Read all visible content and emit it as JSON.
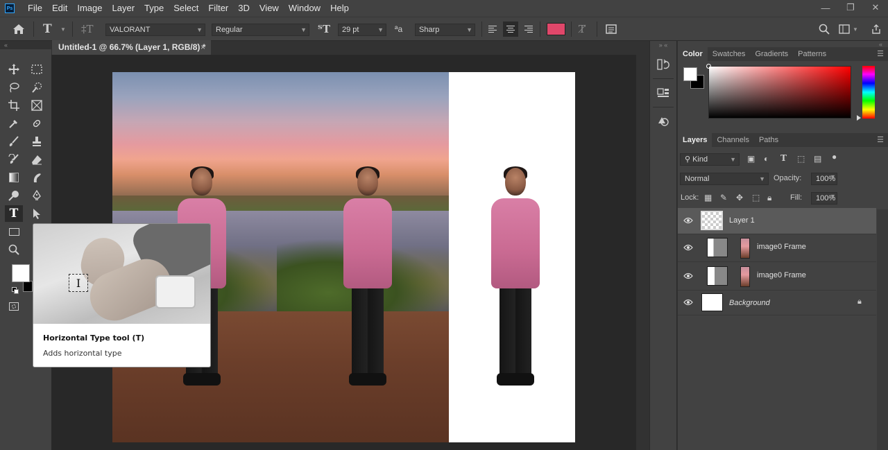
{
  "app": {
    "logo": "Ps"
  },
  "menu": [
    "File",
    "Edit",
    "Image",
    "Layer",
    "Type",
    "Select",
    "Filter",
    "3D",
    "View",
    "Window",
    "Help"
  ],
  "window_controls": {
    "minimize": "—",
    "restore": "❐",
    "close": "✕"
  },
  "options": {
    "font_family": "VALORANT",
    "font_style": "Regular",
    "font_size": "29 pt",
    "aa_label": "ªa",
    "antialias": "Sharp",
    "text_color": "#e0476a"
  },
  "document": {
    "tab_title": "Untitled-1 @ 66.7% (Layer 1, RGB/8) *",
    "close": "×"
  },
  "tooltip": {
    "title": "Horizontal Type tool (T)",
    "description": "Adds horizontal type"
  },
  "color_panel": {
    "tabs": [
      "Color",
      "Swatches",
      "Gradients",
      "Patterns"
    ],
    "active_tab": "Color",
    "foreground": "#ffffff",
    "background": "#000000"
  },
  "layers_panel": {
    "tabs": [
      "Layers",
      "Channels",
      "Paths"
    ],
    "active_tab": "Layers",
    "filter_kind": "Kind",
    "blend_mode": "Normal",
    "opacity_label": "Opacity:",
    "opacity": "100%",
    "lock_label": "Lock:",
    "fill_label": "Fill:",
    "fill": "100%",
    "layers": [
      {
        "name": "Layer 1",
        "selected": true
      },
      {
        "name": "image0 Frame"
      },
      {
        "name": "image0 Frame"
      },
      {
        "name": "Background",
        "locked": true
      }
    ]
  }
}
